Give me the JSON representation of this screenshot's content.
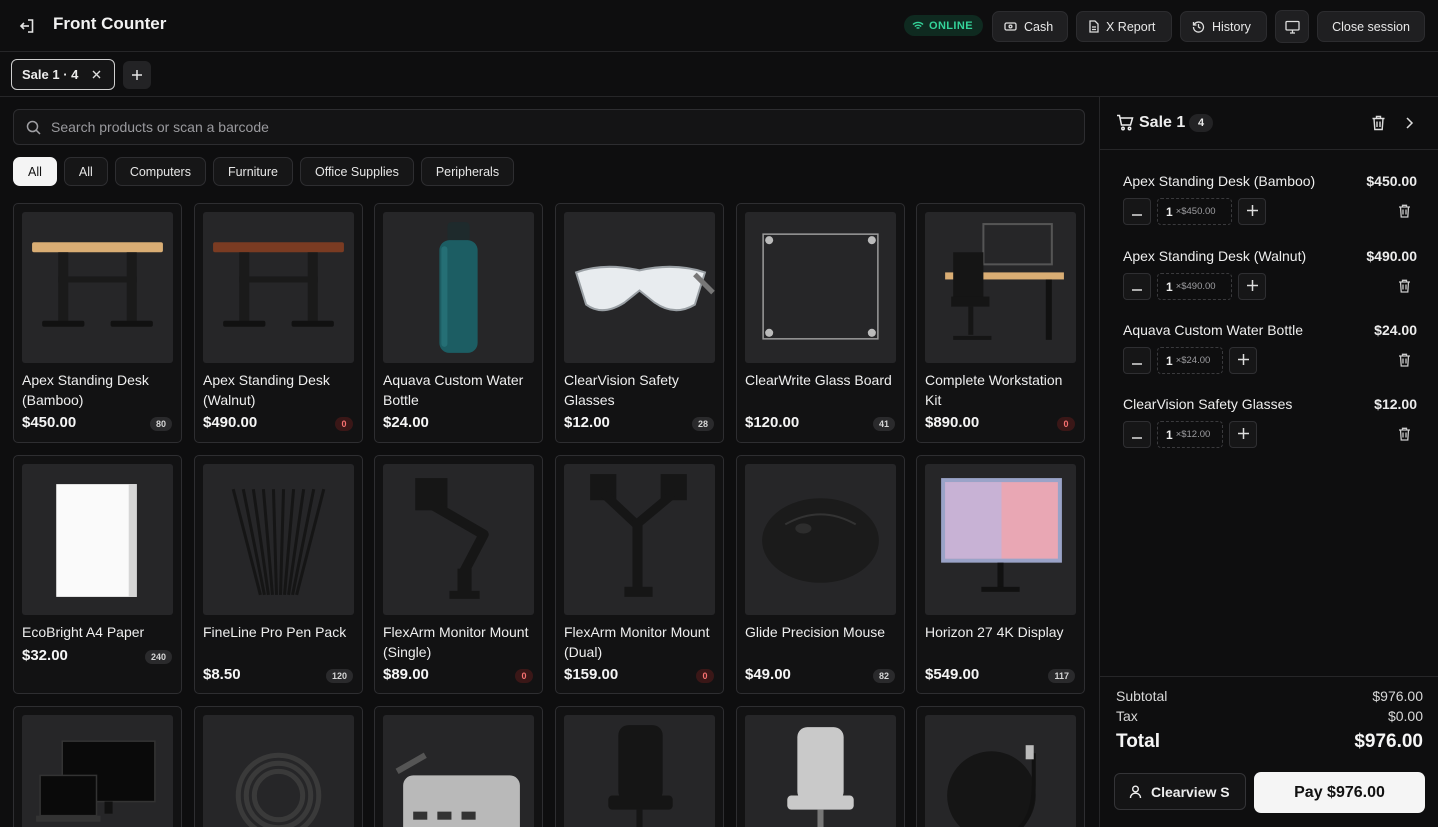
{
  "header": {
    "title": "Front Counter",
    "status": "ONLINE",
    "buttons": {
      "cash": "Cash",
      "x_report": "X Report",
      "history": "History",
      "close_session": "Close session"
    }
  },
  "tabs": {
    "active_tab": "Sale 1 · 4"
  },
  "search": {
    "placeholder": "Search products or scan a barcode"
  },
  "categories": [
    "All",
    "All",
    "Computers",
    "Furniture",
    "Office Supplies",
    "Peripherals"
  ],
  "products": [
    {
      "name": "Apex Standing Desk (Bamboo)",
      "price": "$450.00",
      "stock": "80",
      "icon": "desk-bamboo"
    },
    {
      "name": "Apex Standing Desk (Walnut)",
      "price": "$490.00",
      "stock": "0",
      "icon": "desk-walnut"
    },
    {
      "name": "Aquava Custom Water Bottle",
      "price": "$24.00",
      "stock": "",
      "icon": "water-bottle"
    },
    {
      "name": "ClearVision Safety Glasses",
      "price": "$12.00",
      "stock": "28",
      "icon": "safety-glasses"
    },
    {
      "name": "ClearWrite Glass Board",
      "price": "$120.00",
      "stock": "41",
      "icon": "glass-board"
    },
    {
      "name": "Complete Workstation Kit",
      "price": "$890.00",
      "stock": "0",
      "icon": "workstation"
    },
    {
      "name": "EcoBright A4 Paper",
      "price": "$32.00",
      "stock": "240",
      "icon": "paper-ream"
    },
    {
      "name": "FineLine Pro Pen Pack",
      "price": "$8.50",
      "stock": "120",
      "icon": "pens"
    },
    {
      "name": "FlexArm Monitor Mount (Single)",
      "price": "$89.00",
      "stock": "0",
      "icon": "monitor-arm-single"
    },
    {
      "name": "FlexArm Monitor Mount (Dual)",
      "price": "$159.00",
      "stock": "0",
      "icon": "monitor-arm-dual"
    },
    {
      "name": "Glide Precision Mouse",
      "price": "$49.00",
      "stock": "82",
      "icon": "mouse"
    },
    {
      "name": "Horizon 27 4K Display",
      "price": "$549.00",
      "stock": "117",
      "icon": "display"
    },
    {
      "name": "",
      "price": "",
      "stock": "",
      "icon": "monitor-laptop"
    },
    {
      "name": "",
      "price": "",
      "stock": "",
      "icon": "cable"
    },
    {
      "name": "",
      "price": "",
      "stock": "",
      "icon": "usb-hub"
    },
    {
      "name": "",
      "price": "",
      "stock": "",
      "icon": "office-chair-black"
    },
    {
      "name": "",
      "price": "",
      "stock": "",
      "icon": "office-chair-grey"
    },
    {
      "name": "",
      "price": "",
      "stock": "",
      "icon": "wireless-charger"
    }
  ],
  "cart": {
    "title": "Sale 1",
    "count": "4",
    "lines": [
      {
        "name": "Apex Standing Desk (Bamboo)",
        "total": "$450.00",
        "qty": "1",
        "unit": "×$450.00"
      },
      {
        "name": "Apex Standing Desk (Walnut)",
        "total": "$490.00",
        "qty": "1",
        "unit": "×$490.00"
      },
      {
        "name": "Aquava Custom Water Bottle",
        "total": "$24.00",
        "qty": "1",
        "unit": "×$24.00"
      },
      {
        "name": "ClearVision Safety Glasses",
        "total": "$12.00",
        "qty": "1",
        "unit": "×$12.00"
      }
    ],
    "subtotal_label": "Subtotal",
    "subtotal": "$976.00",
    "tax_label": "Tax",
    "tax": "$0.00",
    "total_label": "Total",
    "total": "$976.00",
    "customer": "Clearview S",
    "pay_label": "Pay $976.00"
  },
  "colors": {
    "online": "#34d399",
    "out_of_stock": "#f87171",
    "background": "#0e0e0f"
  }
}
